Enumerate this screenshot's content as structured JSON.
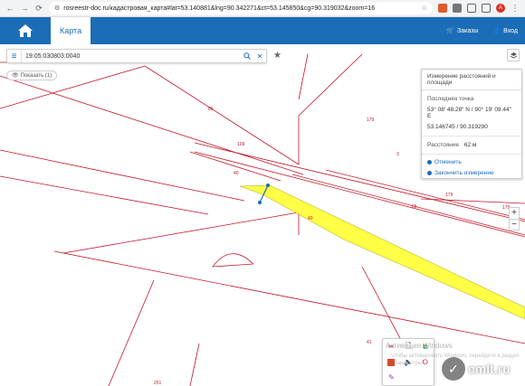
{
  "browser": {
    "url": "rosreestr-doc.ru/кадастровая_карта#lat=53.140881&lng=90.342271&ct=53.145850&cg=90.319032&zoom=16",
    "avatar_letter": "А"
  },
  "header": {
    "tab_map": "Карта",
    "orders_label": "Заказы",
    "login_label": "Вход"
  },
  "search": {
    "value": "19:05:030803:0040"
  },
  "show_button": "Показать (1)",
  "measure": {
    "title": "Измерение расстояний и площади",
    "last_point_label": "Последняя точка",
    "coords_dms": "53° 08' 48.28\" N / 90° 19' 09.44\" E",
    "coords_dec": "53.146745 / 90.319290",
    "distance_label": "Расстояние",
    "distance_value": "62 м",
    "cancel_label": "Отменить",
    "finish_label": "Закончить измерение"
  },
  "map_labels": [
    {
      "text": "65"
    },
    {
      "text": "179"
    },
    {
      "text": "109"
    },
    {
      "text": "40"
    },
    {
      "text": "40"
    },
    {
      "text": "179"
    },
    {
      "text": "65"
    },
    {
      "text": "179"
    },
    {
      "text": "3"
    },
    {
      "text": "41"
    },
    {
      "text": "251"
    }
  ],
  "zoom": {
    "plus": "+",
    "minus": "−"
  },
  "watermark": {
    "line1": "Активация Windows",
    "line2": "Чтобы активировать Windows, перейдите в раздел \"Параметры\"."
  },
  "brand": {
    "text": "cmlt.ru"
  },
  "colors": {
    "header_blue": "#1b6db7",
    "boundary_red": "#c0182a",
    "parcel_yellow": "#ffff33"
  }
}
